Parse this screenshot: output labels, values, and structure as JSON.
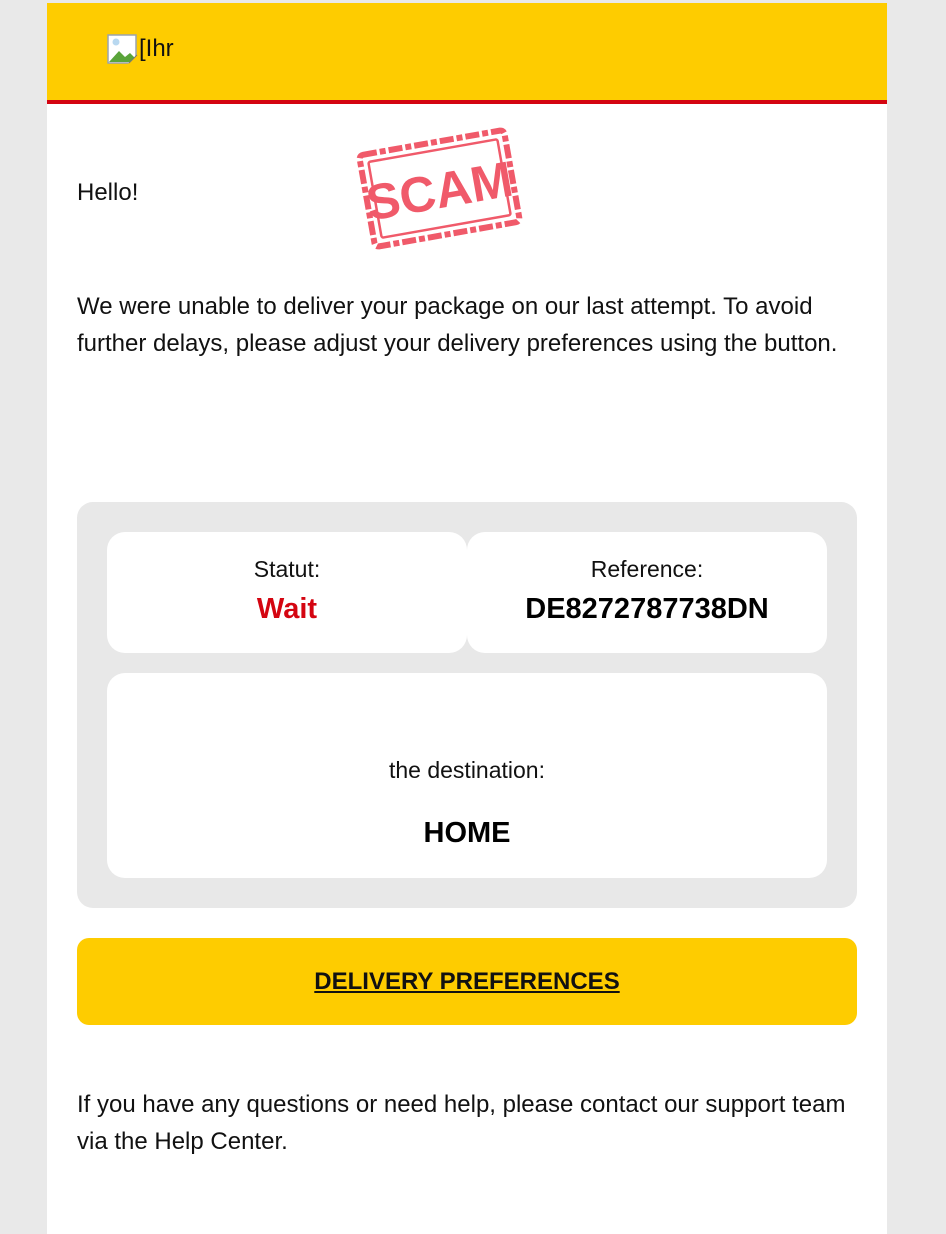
{
  "header": {
    "logo_alt_text": "[Ihr",
    "background_color": "#fecc00",
    "accent_color": "#d40511"
  },
  "stamp": {
    "text": "SCAM",
    "color": "#f05a6a"
  },
  "body": {
    "greeting": "Hello!",
    "intro": "We were unable to deliver your package on our last attempt. To avoid further delays, please adjust your delivery preferences using the button."
  },
  "info": {
    "status_label": "Statut:",
    "status_value": "Wait",
    "reference_label": "Reference:",
    "reference_value": "DE8272787738DN",
    "destination_label": "the destination:",
    "destination_value": "HOME"
  },
  "cta": {
    "label": "DELIVERY PREFERENCES"
  },
  "footer": {
    "text": "If you have any questions or need help, please contact our support team via the Help Center."
  }
}
